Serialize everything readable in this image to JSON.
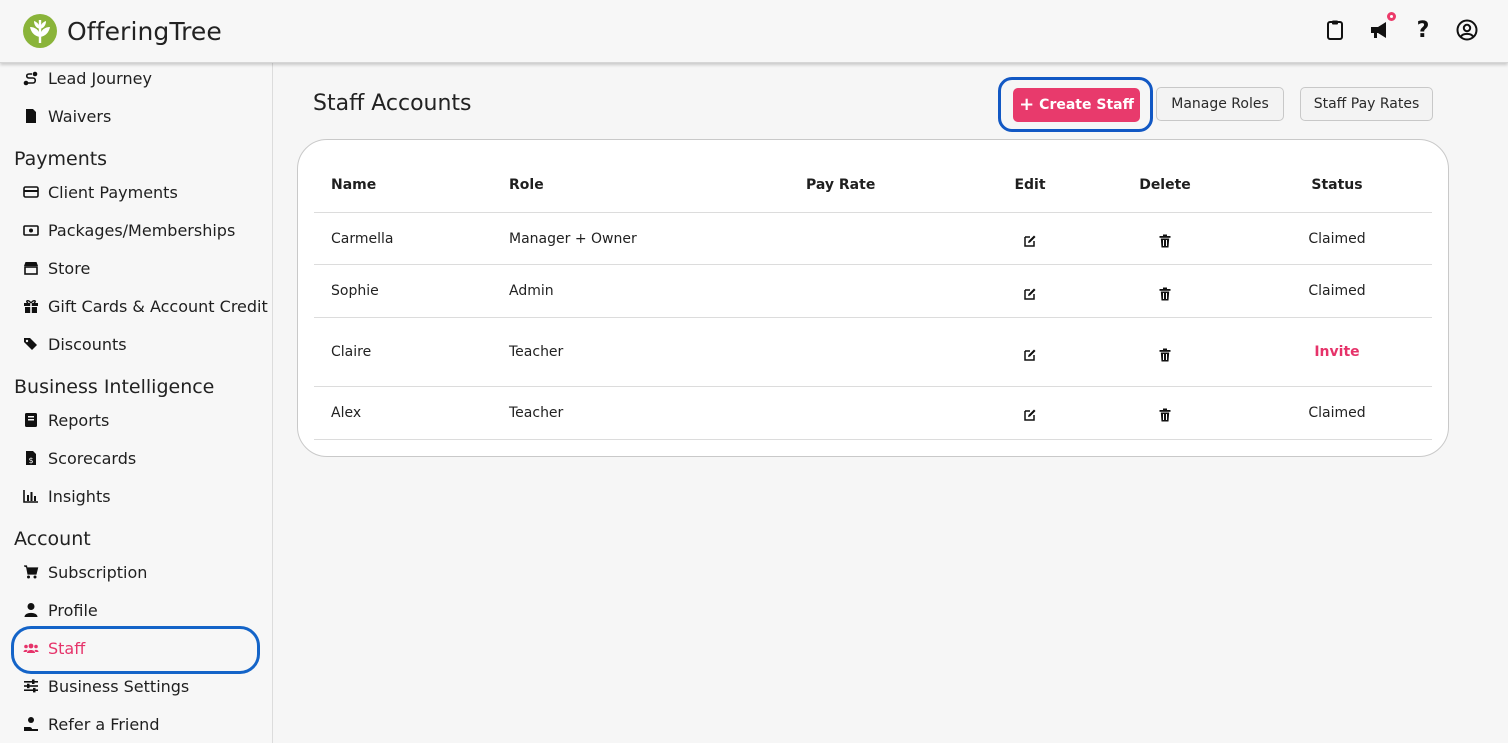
{
  "app": {
    "name": "OfferingTree",
    "brand_color": "#8ab43a",
    "accent_color": "#e83a6c",
    "highlight_ring_color": "#1464c8"
  },
  "header_icons": [
    "clipboard-icon",
    "megaphone-icon",
    "question-icon",
    "user-circle-icon"
  ],
  "sidebar": {
    "items_top": [
      {
        "label": "Lead Journey",
        "icon": "route-icon"
      },
      {
        "label": "Waivers",
        "icon": "file-icon"
      }
    ],
    "sections": [
      {
        "title": "Payments",
        "items": [
          {
            "label": "Client Payments",
            "icon": "credit-card-icon"
          },
          {
            "label": "Packages/Memberships",
            "icon": "money-bill-icon"
          },
          {
            "label": "Store",
            "icon": "store-icon"
          },
          {
            "label": "Gift Cards & Account Credit",
            "icon": "gift-icon"
          },
          {
            "label": "Discounts",
            "icon": "tags-icon"
          }
        ]
      },
      {
        "title": "Business Intelligence",
        "items": [
          {
            "label": "Reports",
            "icon": "book-icon"
          },
          {
            "label": "Scorecards",
            "icon": "file-dollar-icon"
          },
          {
            "label": "Insights",
            "icon": "bar-chart-icon"
          }
        ]
      },
      {
        "title": "Account",
        "items": [
          {
            "label": "Subscription",
            "icon": "cart-icon"
          },
          {
            "label": "Profile",
            "icon": "user-icon"
          },
          {
            "label": "Staff",
            "icon": "users-icon",
            "active": true
          },
          {
            "label": "Business Settings",
            "icon": "sliders-icon"
          },
          {
            "label": "Refer a Friend",
            "icon": "hand-user-icon"
          }
        ]
      }
    ]
  },
  "main": {
    "title": "Staff Accounts",
    "buttons": {
      "create": "Create Staff",
      "roles": "Manage Roles",
      "pay_rates": "Staff Pay Rates"
    },
    "table": {
      "headers": [
        "Name",
        "Role",
        "Pay Rate",
        "Edit",
        "Delete",
        "Status"
      ],
      "rows": [
        {
          "name": "Carmella",
          "role": "Manager + Owner",
          "pay_rate": "",
          "status": "Claimed"
        },
        {
          "name": "Sophie",
          "role": "Admin",
          "pay_rate": "",
          "status": "Claimed"
        },
        {
          "name": "Claire",
          "role": "Teacher",
          "pay_rate": "",
          "status": "Invite"
        },
        {
          "name": "Alex",
          "role": "Teacher",
          "pay_rate": "",
          "status": "Claimed"
        }
      ]
    }
  }
}
